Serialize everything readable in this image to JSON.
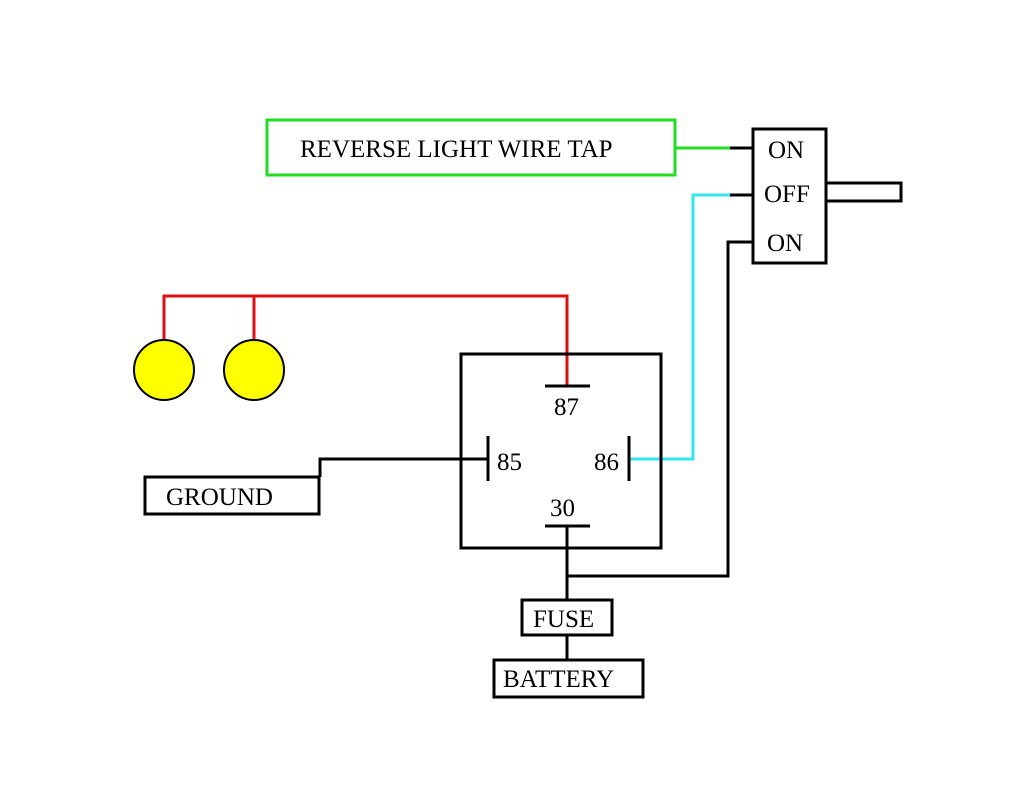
{
  "labels": {
    "reverse_tap": "REVERSE LIGHT WIRE TAP",
    "switch_on_top": "ON",
    "switch_off": "OFF",
    "switch_on_bottom": "ON",
    "pin87": "87",
    "pin85": "85",
    "pin86": "86",
    "pin30": "30",
    "ground": "GROUND",
    "fuse": "FUSE",
    "battery": "BATTERY"
  },
  "colors": {
    "tap_wire": "#22dd22",
    "switch_wire": "#33e5ee",
    "lamp_wire": "#dd1111",
    "lamp_fill": "#ffff00",
    "wire": "#000000"
  }
}
